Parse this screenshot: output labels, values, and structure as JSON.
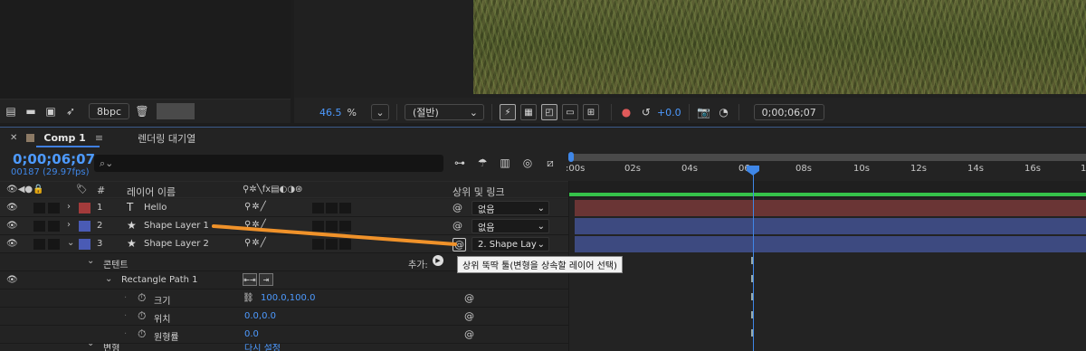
{
  "project": {
    "bpc": "8bpc"
  },
  "viewer": {
    "zoom": "46.5",
    "zoom_unit": "%",
    "resolution": "(절반)",
    "exposure": "+0.0",
    "timecode": "0;00;06;07"
  },
  "timeline": {
    "tabs": [
      {
        "label": "Comp 1"
      },
      {
        "label": "렌더링 대기열"
      }
    ],
    "current_time": "0;00;06;07",
    "frame_info": "00187 (29.97fps)",
    "search_placeholder": "",
    "ruler_labels": [
      ":00s",
      "02s",
      "04s",
      "06s",
      "08s",
      "10s",
      "12s",
      "14s",
      "16s",
      "1"
    ],
    "columns": {
      "number": "#",
      "layer_name": "레이어 이름",
      "parent": "상위 및 링크"
    },
    "layers": [
      {
        "number": "1",
        "type_icon": "T",
        "name": "Hello",
        "label_color": "#a33b3b",
        "parent": "없음",
        "bar_color": "#6a3535",
        "expanded": false
      },
      {
        "number": "2",
        "type_icon": "★",
        "name": "Shape Layer 1",
        "label_color": "#4a5bb5",
        "parent": "없음",
        "bar_color": "#3d4a80",
        "expanded": false
      },
      {
        "number": "3",
        "type_icon": "★",
        "name": "Shape Layer 2",
        "label_color": "#4a5bb5",
        "parent": "2. Shape Lay",
        "bar_color": "#3d4a80",
        "expanded": true
      }
    ],
    "contents": {
      "label": "콘텐트",
      "add_label": "추가:",
      "rect_path": "Rectangle Path 1",
      "props": [
        {
          "name": "크기",
          "value": "100.0,100.0"
        },
        {
          "name": "위치",
          "value": "0.0,0.0"
        },
        {
          "name": "원형률",
          "value": "0.0"
        }
      ],
      "transform_label": "변형",
      "transform_value": "다시 설정"
    },
    "tooltip": "상위 뚝딱 툴(변형을 상속할 레이어 선택)",
    "colors": {
      "accent": "#3f87e8",
      "work_area": "#36c24a",
      "pickwhip": "#f0922a"
    }
  }
}
